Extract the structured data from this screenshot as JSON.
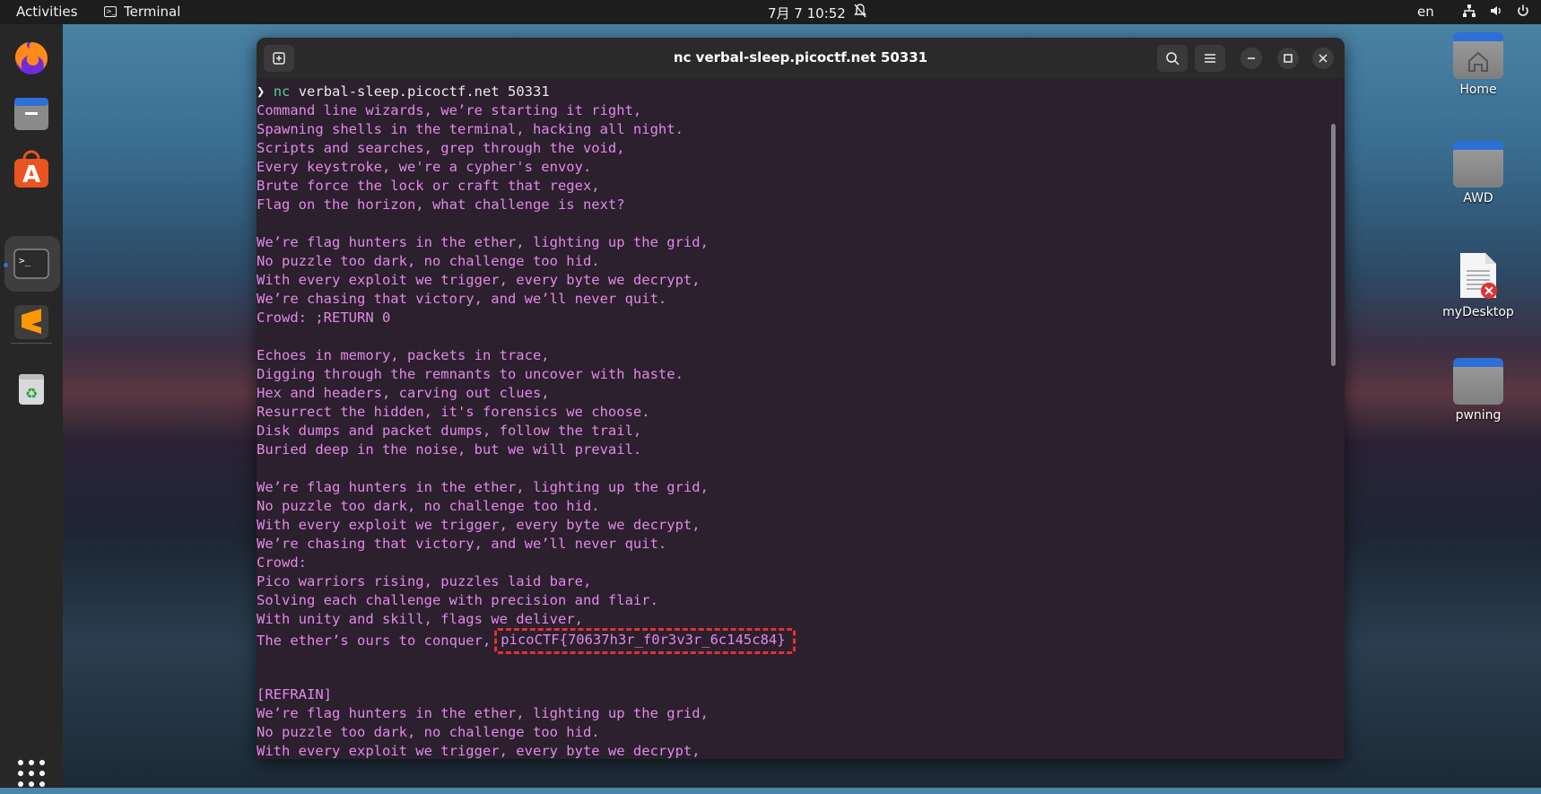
{
  "topbar": {
    "activities": "Activities",
    "app_name": "Terminal",
    "clock": "7月 7  10:52",
    "lang": "en"
  },
  "desktop": {
    "items": [
      {
        "label": "Home",
        "icon": "home-folder-icon"
      },
      {
        "label": "AWD",
        "icon": "folder-icon"
      },
      {
        "label": "myDesktop",
        "icon": "text-file-icon"
      },
      {
        "label": "pwning",
        "icon": "folder-icon"
      }
    ]
  },
  "window": {
    "title": "nc verbal-sleep.picoctf.net 50331"
  },
  "terminal": {
    "prompt_arrow": "❯",
    "prompt_cmd": "nc",
    "prompt_args": "verbal-sleep.picoctf.net 50331",
    "lines": [
      "Command line wizards, we’re starting it right,",
      "Spawning shells in the terminal, hacking all night.",
      "Scripts and searches, grep through the void,",
      "Every keystroke, we're a cypher's envoy.",
      "Brute force the lock or craft that regex,",
      "Flag on the horizon, what challenge is next?",
      "",
      "We’re flag hunters in the ether, lighting up the grid,",
      "No puzzle too dark, no challenge too hid.",
      "With every exploit we trigger, every byte we decrypt,",
      "We’re chasing that victory, and we’ll never quit.",
      "Crowd: ;RETURN 0",
      "",
      "Echoes in memory, packets in trace,",
      "Digging through the remnants to uncover with haste.",
      "Hex and headers, carving out clues,",
      "Resurrect the hidden, it's forensics we choose.",
      "Disk dumps and packet dumps, follow the trail,",
      "Buried deep in the noise, but we will prevail.",
      "",
      "We’re flag hunters in the ether, lighting up the grid,",
      "No puzzle too dark, no challenge too hid.",
      "With every exploit we trigger, every byte we decrypt,",
      "We’re chasing that victory, and we’ll never quit.",
      "Crowd:",
      "Pico warriors rising, puzzles laid bare,",
      "Solving each challenge with precision and flair.",
      "With unity and skill, flags we deliver,"
    ],
    "flag_line_prefix": "The ether’s ours to conquer,",
    "flag": "picoCTF{70637h3r_f0r3v3r_6c145c84}",
    "after_lines": [
      "",
      "",
      "[REFRAIN]",
      "We’re flag hunters in the ether, lighting up the grid,",
      "No puzzle too dark, no challenge too hid.",
      "With every exploit we trigger, every byte we decrypt,"
    ]
  },
  "colors": {
    "terminal_text": "#e08ae6",
    "terminal_bg": "#2c1f2e",
    "highlight": "#e03232",
    "command": "#4fd48c"
  }
}
